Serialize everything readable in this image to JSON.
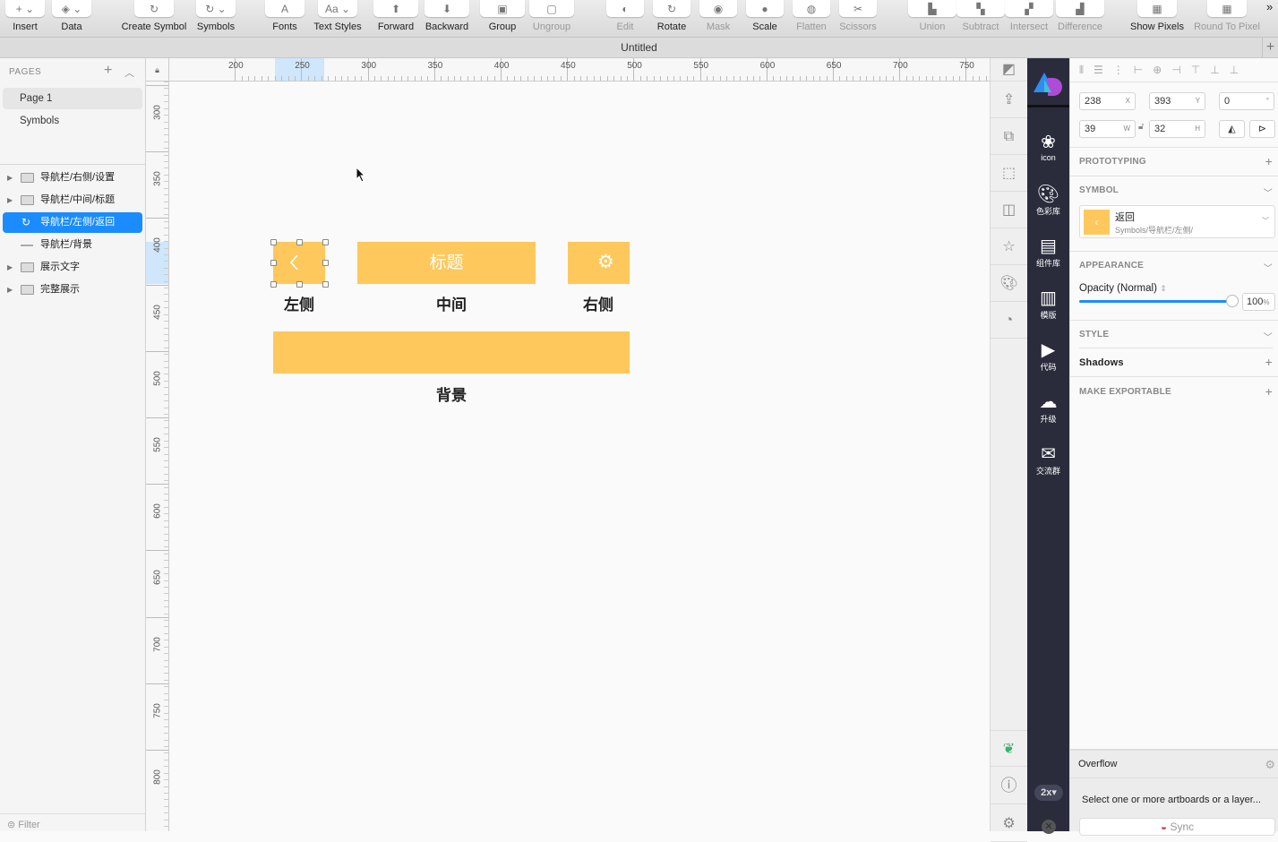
{
  "toolbar": {
    "items": [
      {
        "label": "Insert",
        "icon": "+ ⌄"
      },
      {
        "label": "Data",
        "icon": "◈ ⌄"
      },
      {
        "label": "Create Symbol",
        "icon": "↻"
      },
      {
        "label": "Symbols",
        "icon": "↻ ⌄"
      },
      {
        "label": "Fonts",
        "icon": "A"
      },
      {
        "label": "Text Styles",
        "icon": "Aa ⌄"
      },
      {
        "label": "Forward",
        "icon": "⬆"
      },
      {
        "label": "Backward",
        "icon": "⬇"
      },
      {
        "label": "Group",
        "icon": "▣"
      },
      {
        "label": "Ungroup",
        "icon": "▢"
      },
      {
        "label": "Edit",
        "icon": "◐"
      },
      {
        "label": "Rotate",
        "icon": "↻"
      },
      {
        "label": "Mask",
        "icon": "◉"
      },
      {
        "label": "Scale",
        "icon": "●"
      },
      {
        "label": "Flatten",
        "icon": "◍"
      },
      {
        "label": "Scissors",
        "icon": "✂"
      },
      {
        "label": "Union",
        "icon": "▙"
      },
      {
        "label": "Subtract",
        "icon": "▚"
      },
      {
        "label": "Intersect",
        "icon": "▞"
      },
      {
        "label": "Difference",
        "icon": "▟"
      },
      {
        "label": "Show Pixels",
        "icon": "▦"
      },
      {
        "label": "Round To Pixel",
        "icon": "▦"
      }
    ],
    "more": "»"
  },
  "document": {
    "title": "Untitled"
  },
  "pages": {
    "header": "PAGES",
    "items": [
      "Page 1",
      "Symbols"
    ]
  },
  "layers": [
    {
      "name": "导航栏/右侧/设置",
      "type": "folder"
    },
    {
      "name": "导航栏/中间/标题",
      "type": "folder"
    },
    {
      "name": "导航栏/左侧/返回",
      "type": "symbol",
      "selected": true
    },
    {
      "name": "导航栏/背景",
      "type": "rect"
    },
    {
      "name": "展示文字",
      "type": "folder"
    },
    {
      "name": "完整展示",
      "type": "folder"
    }
  ],
  "filter": "Filter",
  "rulers": {
    "h": [
      "200",
      "250",
      "300",
      "350",
      "400",
      "450",
      "500",
      "550",
      "600",
      "650",
      "700",
      "750"
    ],
    "v": [
      "300",
      "350",
      "400",
      "450",
      "500",
      "550",
      "600",
      "650",
      "700",
      "750",
      "800"
    ]
  },
  "canvas": {
    "title_text": "标题",
    "labels": {
      "left": "左侧",
      "middle": "中间",
      "right": "右侧",
      "bg": "背景"
    },
    "fill": "#ffc85c"
  },
  "plugin": {
    "items": [
      "icon",
      "色彩库",
      "组件库",
      "模版",
      "代码",
      "升级",
      "交流群"
    ],
    "zoom": "2x"
  },
  "inspector": {
    "x": "238",
    "y": "393",
    "rotation": "0",
    "w": "39",
    "h": "32",
    "labels": {
      "x": "X",
      "y": "Y",
      "deg": "°",
      "w": "W",
      "h": "H"
    },
    "prototyping": "PROTOTYPING",
    "symbol": "SYMBOL",
    "symbol_name": "返回",
    "symbol_path": "Symbols/导航栏/左侧/",
    "appearance": "APPEARANCE",
    "opacity_label": "Opacity (Normal)",
    "opacity": "100",
    "opacity_unit": "%",
    "opacity_value": 1.0,
    "style": "STYLE",
    "shadows": "Shadows",
    "exportable": "MAKE EXPORTABLE",
    "overflow": "Overflow",
    "overflow_msg": "Select one or more artboards or a layer...",
    "sync": "Sync"
  },
  "colors": {
    "accent": "#1a8cff",
    "dark_panel": "#2a2c3c"
  }
}
